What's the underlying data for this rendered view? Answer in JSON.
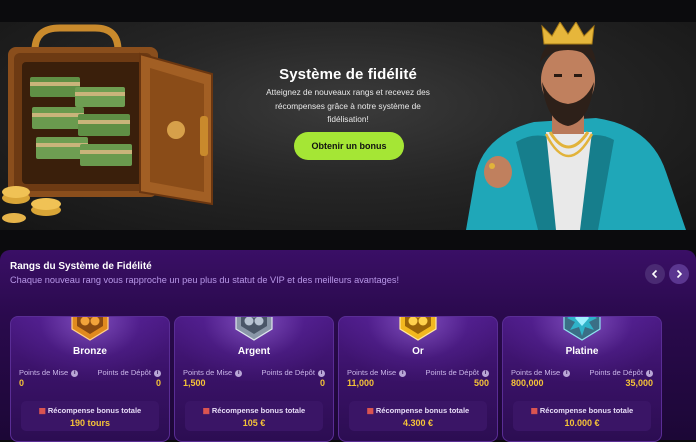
{
  "hero": {
    "title": "Système de fidélité",
    "text": "Atteignez de nouveaux rangs et recevez des récompenses grâce à notre système de fidélisation!",
    "button_label": "Obtenir un bonus",
    "colors": {
      "button": "#a5e635"
    }
  },
  "loyalty": {
    "title": "Rangs du Système de Fidélité",
    "subtitle": "Chaque nouveau rang vous rapproche un peu plus du statut de VIP et des meilleurs avantages!",
    "prev_icon": "chevron-left-icon",
    "next_icon": "chevron-right-icon",
    "ranks": [
      {
        "name": "Bronze",
        "badge_color": "#e08a1e",
        "bet_label": "Points de Mise",
        "bet_value": "0",
        "deposit_label": "Points de Dépôt",
        "deposit_value": "0",
        "reward_label": "Récompense bonus totale",
        "reward_value": "190 tours"
      },
      {
        "name": "Argent",
        "badge_color": "#8a97a8",
        "bet_label": "Points de Mise",
        "bet_value": "1,500",
        "deposit_label": "Points de Dépôt",
        "deposit_value": "0",
        "reward_label": "Récompense bonus totale",
        "reward_value": "105 €"
      },
      {
        "name": "Or",
        "badge_color": "#f2b81e",
        "bet_label": "Points de Mise",
        "bet_value": "11,000",
        "deposit_label": "Points de Dépôt",
        "deposit_value": "500",
        "reward_label": "Récompense bonus totale",
        "reward_value": "4.300 €"
      },
      {
        "name": "Platine",
        "badge_color": "#2fb3c9",
        "bet_label": "Points de Mise",
        "bet_value": "800,000",
        "deposit_label": "Points de Dépôt",
        "deposit_value": "35,000",
        "reward_label": "Récompense bonus totale",
        "reward_value": "10.000 €"
      }
    ]
  }
}
